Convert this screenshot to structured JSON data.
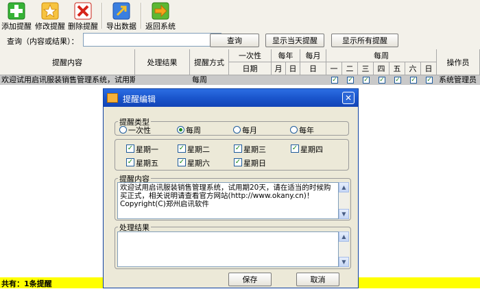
{
  "toolbar": {
    "buttons": [
      {
        "label": "添加提醒",
        "icon": "plus-icon",
        "color": "#2ea02e"
      },
      {
        "label": "修改提醒",
        "icon": "star-icon",
        "color": "#e8a21a"
      },
      {
        "label": "删除提醒",
        "icon": "delete-x-icon",
        "color": "#d6241a"
      },
      {
        "label": "导出数据",
        "icon": "export-icon",
        "color": "#2a6fd6"
      },
      {
        "label": "返回系统",
        "icon": "back-arrow-icon",
        "color": "#44a02a"
      }
    ]
  },
  "search": {
    "label": "查询（内容或结果）：",
    "value": "",
    "query_button": "查询",
    "show_today_button": "显示当天提醒",
    "show_all_button": "显示所有提醒"
  },
  "table": {
    "headers": {
      "content": "提醒内容",
      "result": "处理结果",
      "method": "提醒方式",
      "once": "一次性",
      "date": "日期",
      "yearly": "每年",
      "month": "月",
      "day": "日",
      "monthly": "每月",
      "monthly_day": "日",
      "weekly": "每周",
      "weekdays": [
        "一",
        "二",
        "三",
        "四",
        "五",
        "六",
        "日"
      ],
      "operator": "操作员"
    },
    "rows": [
      {
        "content": "欢迎试用启讯服装销售管理系统，试用期",
        "result": "",
        "method": "每周",
        "weekdays_checked": [
          true,
          true,
          true,
          true,
          true,
          true,
          true
        ],
        "operator": "系统管理员"
      }
    ],
    "footer": "共有：1条提醒"
  },
  "dialog": {
    "title": "提醒编辑",
    "type_group": "提醒类型",
    "type_options": [
      "一次性",
      "每周",
      "每月",
      "每年"
    ],
    "type_selected": "每周",
    "weekdays": [
      "星期一",
      "星期二",
      "星期三",
      "星期四",
      "星期五",
      "星期六",
      "星期日"
    ],
    "weekdays_checked": [
      true,
      true,
      true,
      true,
      true,
      true,
      true
    ],
    "content_group": "提醒内容",
    "content_text": "欢迎试用启讯服装销售管理系统，试用期20天，请在适当的时候购买正式，相关说明请查看官方网站(http://www.okany.cn)！\nCopyright(C)郑州启讯软件",
    "result_group": "处理结果",
    "result_text": "",
    "save_button": "保存",
    "cancel_button": "取消"
  }
}
